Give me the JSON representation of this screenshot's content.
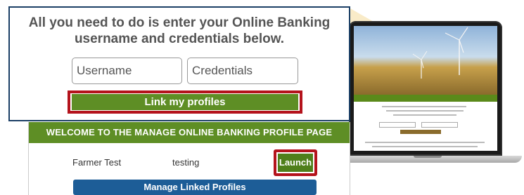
{
  "callout": {
    "headline": "All you need to do is enter your Online Banking username and credentials below.",
    "username_placeholder": "Username",
    "credentials_placeholder": "Credentials",
    "link_button": "Link my profiles"
  },
  "profile_page": {
    "welcome_title": "WELCOME TO THE MANAGE ONLINE BANKING PROFILE PAGE",
    "profile_name": "Farmer Test",
    "profile_value": "testing",
    "launch_button": "Launch",
    "manage_button": "Manage Linked Profiles"
  },
  "colors": {
    "green": "#5e8e25",
    "blue": "#1d5d97",
    "highlight_red": "#b4131c",
    "navy_border": "#1b3f66"
  }
}
